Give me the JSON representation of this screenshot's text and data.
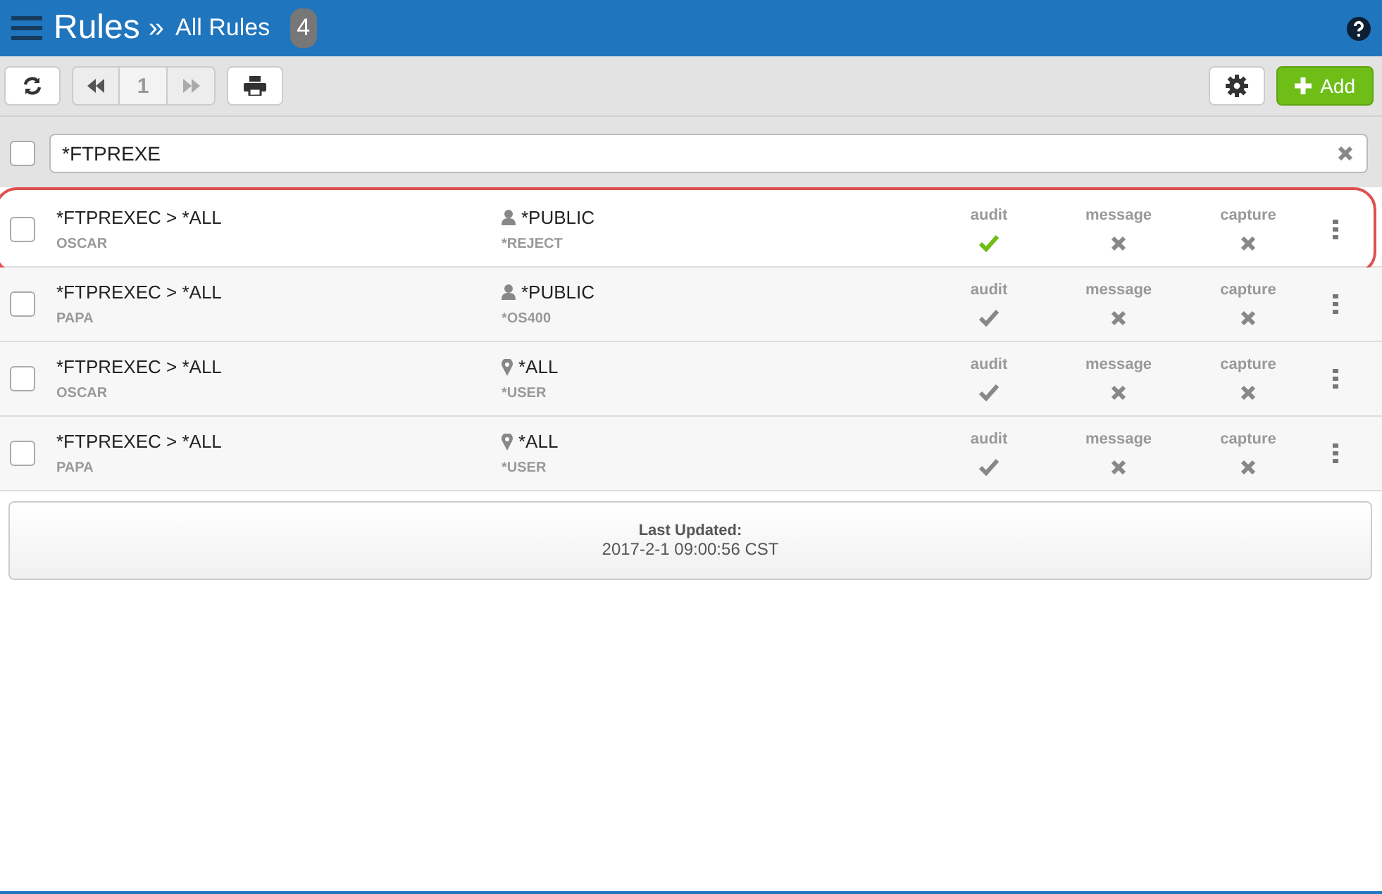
{
  "header": {
    "title": "Rules",
    "separator": "»",
    "subtitle": "All Rules",
    "count": "4"
  },
  "toolbar": {
    "page": "1",
    "add_label": "Add"
  },
  "filter": {
    "checked": false,
    "value": "*FTPREXE"
  },
  "rows": [
    {
      "selected": true,
      "checked": false,
      "name": "*FTPREXEC > *ALL",
      "owner": "OSCAR",
      "target": {
        "kind": "user",
        "label": "*PUBLIC"
      },
      "action": "*REJECT",
      "flags": [
        {
          "label": "audit",
          "on": true
        },
        {
          "label": "message",
          "on": false
        },
        {
          "label": "capture",
          "on": false
        }
      ]
    },
    {
      "selected": false,
      "checked": false,
      "name": "*FTPREXEC > *ALL",
      "owner": "PAPA",
      "target": {
        "kind": "user",
        "label": "*PUBLIC"
      },
      "action": "*OS400",
      "flags": [
        {
          "label": "audit",
          "on": true
        },
        {
          "label": "message",
          "on": false
        },
        {
          "label": "capture",
          "on": false
        }
      ]
    },
    {
      "selected": false,
      "checked": false,
      "name": "*FTPREXEC > *ALL",
      "owner": "OSCAR",
      "target": {
        "kind": "location",
        "label": "*ALL"
      },
      "action": "*USER",
      "flags": [
        {
          "label": "audit",
          "on": true
        },
        {
          "label": "message",
          "on": false
        },
        {
          "label": "capture",
          "on": false
        }
      ]
    },
    {
      "selected": false,
      "checked": false,
      "name": "*FTPREXEC > *ALL",
      "owner": "PAPA",
      "target": {
        "kind": "location",
        "label": "*ALL"
      },
      "action": "*USER",
      "flags": [
        {
          "label": "audit",
          "on": true
        },
        {
          "label": "message",
          "on": false
        },
        {
          "label": "capture",
          "on": false
        }
      ]
    }
  ],
  "footer": {
    "label": "Last Updated:",
    "value": "2017-2-1 09:00:56 CST"
  }
}
